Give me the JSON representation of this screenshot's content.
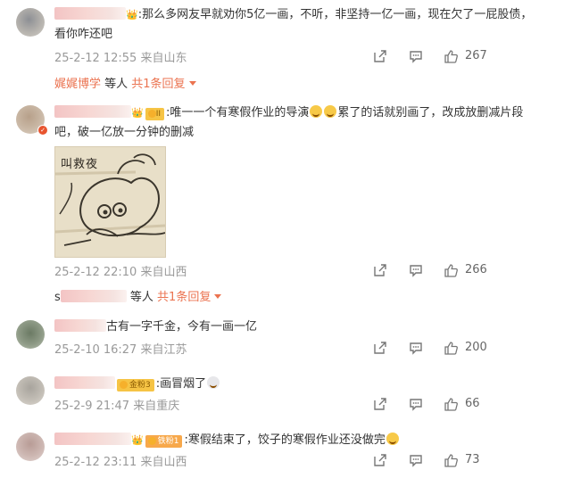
{
  "comments": [
    {
      "text_a": ":那么多网友早就劝你5亿一画，不听，非坚持一亿一画，现在欠了一屁股债，",
      "text_b": "看你咋还吧",
      "time": "25-2-12 12:55 来自山东",
      "likes": "267",
      "reply": {
        "user": "娓娓博学",
        "middle": " 等人 ",
        "link": "共1条回复"
      }
    },
    {
      "badge": "II",
      "text_a": ":唯一一个有寒假作业的导演",
      "text_b": "累了的话就别画了，改成放删减片段",
      "text_c": "吧，破一亿放一分钟的删减",
      "image_caption": "叫救夜",
      "time": "25-2-12 22:10 来自山西",
      "likes": "266",
      "reply": {
        "user": "s",
        "middle": " 等人 ",
        "link": "共1条回复"
      }
    },
    {
      "text_a": "古有一字千金，今有一画一亿",
      "time": "25-2-10 16:27 来自江苏",
      "likes": "200"
    },
    {
      "tag": "金粉3",
      "text_a": ":画冒烟了",
      "time": "25-2-9 21:47 来自重庆",
      "likes": "66"
    },
    {
      "tag": "铁粉1",
      "text_a": ":寒假结束了，饺子的寒假作业还没做完",
      "time": "25-2-12 23:11 来自山西",
      "likes": "73"
    }
  ],
  "icons": {
    "share": "share-icon",
    "comment": "comment-icon",
    "like": "thumbs-up-icon"
  },
  "colors": {
    "accent": "#eb7350",
    "meta": "#999999",
    "text": "#333333"
  }
}
